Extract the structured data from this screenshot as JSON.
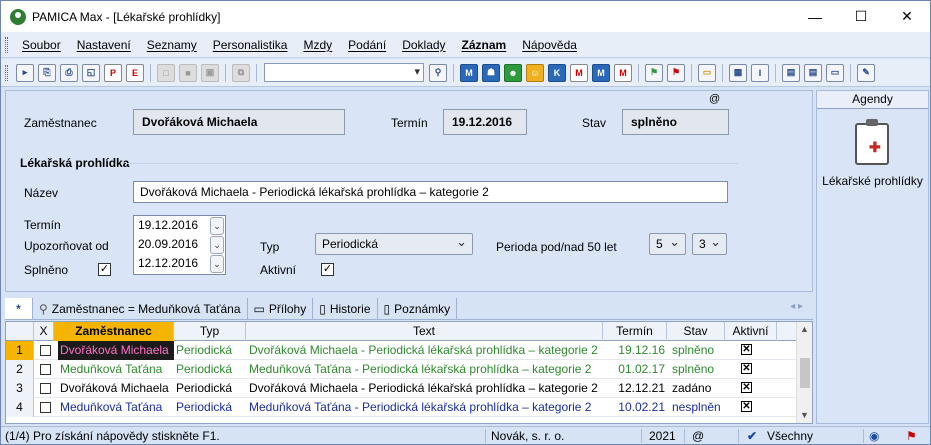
{
  "window": {
    "title": "PAMICA Max - [Lékařské prohlídky]",
    "minimize": "—",
    "maximize": "☐",
    "close": "✕"
  },
  "menu": [
    "Soubor",
    "Nastavení",
    "Seznamy",
    "Personalistika",
    "Mzdy",
    "Podání",
    "Doklady",
    "Záznam",
    "Nápověda"
  ],
  "form": {
    "employee_label": "Zaměstnanec",
    "employee_value": "Dvořáková Michaela",
    "term_label": "Termín",
    "term_value": "19.12.2016",
    "state_label": "Stav",
    "state_value": "splněno",
    "at_symbol": "@",
    "section_title": "Lékařská prohlídka",
    "name_label": "Název",
    "name_value": "Dvořáková Michaela - Periodická lékařská prohlídka – kategorie 2",
    "term2_label": "Termín",
    "notify_label": "Upozorňovat od",
    "done_label": "Splněno",
    "dates": [
      "19.12.2016",
      "20.09.2016",
      "12.12.2016"
    ],
    "type_label": "Typ",
    "type_value": "Periodická",
    "active_label": "Aktivní",
    "period_label": "Perioda pod/nad 50 let",
    "period_under": "5",
    "period_over": "3",
    "done_checked": "✓",
    "active_checked": "✓"
  },
  "side": {
    "header": "Agendy",
    "item": "Lékařské prohlídky",
    "icon": "medical-clipboard-icon"
  },
  "tabs": {
    "star": "*",
    "filter": "Zaměstnanec = Meduňková Taťána",
    "attachments": "Přílohy",
    "history": "Historie",
    "notes": "Poznámky",
    "nav": "◂ ▸"
  },
  "grid": {
    "headers": [
      "X",
      "Zaměstnanec",
      "Typ",
      "Text",
      "Termín",
      "Stav",
      "Aktivní"
    ],
    "rows": [
      {
        "num": "1",
        "employee": "Dvořáková Michaela",
        "type": "Periodická",
        "text": "Dvořáková Michaela - Periodická lékařská prohlídka – kategorie 2",
        "term": "19.12.16",
        "state": "splněno",
        "active": "✕",
        "color": "#2e8b2e",
        "emp_color": "#ff70c8",
        "selected": true
      },
      {
        "num": "2",
        "employee": "Meduňková Taťána",
        "type": "Periodická",
        "text": "Meduňková Taťána - Periodická lékařská prohlídka – kategorie 2",
        "term": "01.02.17",
        "state": "splněno",
        "active": "✕",
        "color": "#2e8b2e",
        "emp_color": "#2e8b2e",
        "selected": false
      },
      {
        "num": "3",
        "employee": "Dvořáková Michaela",
        "type": "Periodická",
        "text": "Dvořáková Michaela - Periodická lékařská prohlídka – kategorie 2",
        "term": "12.12.21",
        "state": "zadáno",
        "active": "✕",
        "color": "#000000",
        "emp_color": "#000000",
        "selected": false
      },
      {
        "num": "4",
        "employee": "Meduňková Taťána",
        "type": "Periodická",
        "text": "Meduňková Taťána - Periodická lékařská prohlídka – kategorie 2",
        "term": "10.02.21",
        "state": "nesplněn",
        "active": "✕",
        "color": "#1a2fa0",
        "emp_color": "#1a2fa0",
        "selected": false
      }
    ]
  },
  "status": {
    "help": "(1/4) Pro získání nápovědy stiskněte F1.",
    "company": "Novák, s. r. o.",
    "year": "2021",
    "at": "@",
    "filter": "Všechny"
  }
}
